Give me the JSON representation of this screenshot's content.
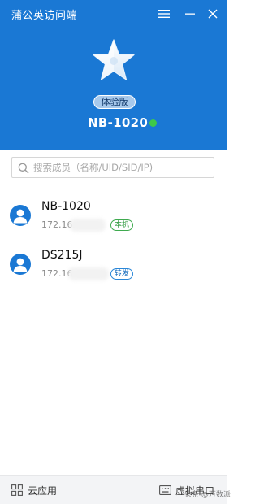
{
  "window": {
    "title": "蒲公英访问端",
    "menu_icon": "menu-icon",
    "minimize_icon": "minimize-icon",
    "close_icon": "close-icon"
  },
  "profile": {
    "logo_icon": "star-icon",
    "edition_badge": "体验版",
    "device_name": "NB-1020",
    "online_status_color": "#3ec94a"
  },
  "search": {
    "placeholder": "搜索成员（名称/UID/SID/IP)",
    "value": ""
  },
  "members": [
    {
      "name": "NB-1020",
      "ip": "172.16.",
      "tag": "本机",
      "tag_color": "#3faa4f",
      "avatar_icon": "user-avatar-icon"
    },
    {
      "name": "DS215J",
      "ip": "172.16.",
      "tag": "转发",
      "tag_color": "#2a87d8",
      "avatar_icon": "user-avatar-icon"
    }
  ],
  "footer": {
    "cloud_apps_label": "云应用",
    "cloud_apps_icon": "grid-icon",
    "virtual_serial_label": "虚拟串口",
    "virtual_serial_icon": "keyboard-icon"
  },
  "watermark": "头条 @万数派",
  "colors": {
    "header_bg": "#1a78d4",
    "badge_bg": "#a7c9ec",
    "footer_bg": "#f3f4f6"
  }
}
